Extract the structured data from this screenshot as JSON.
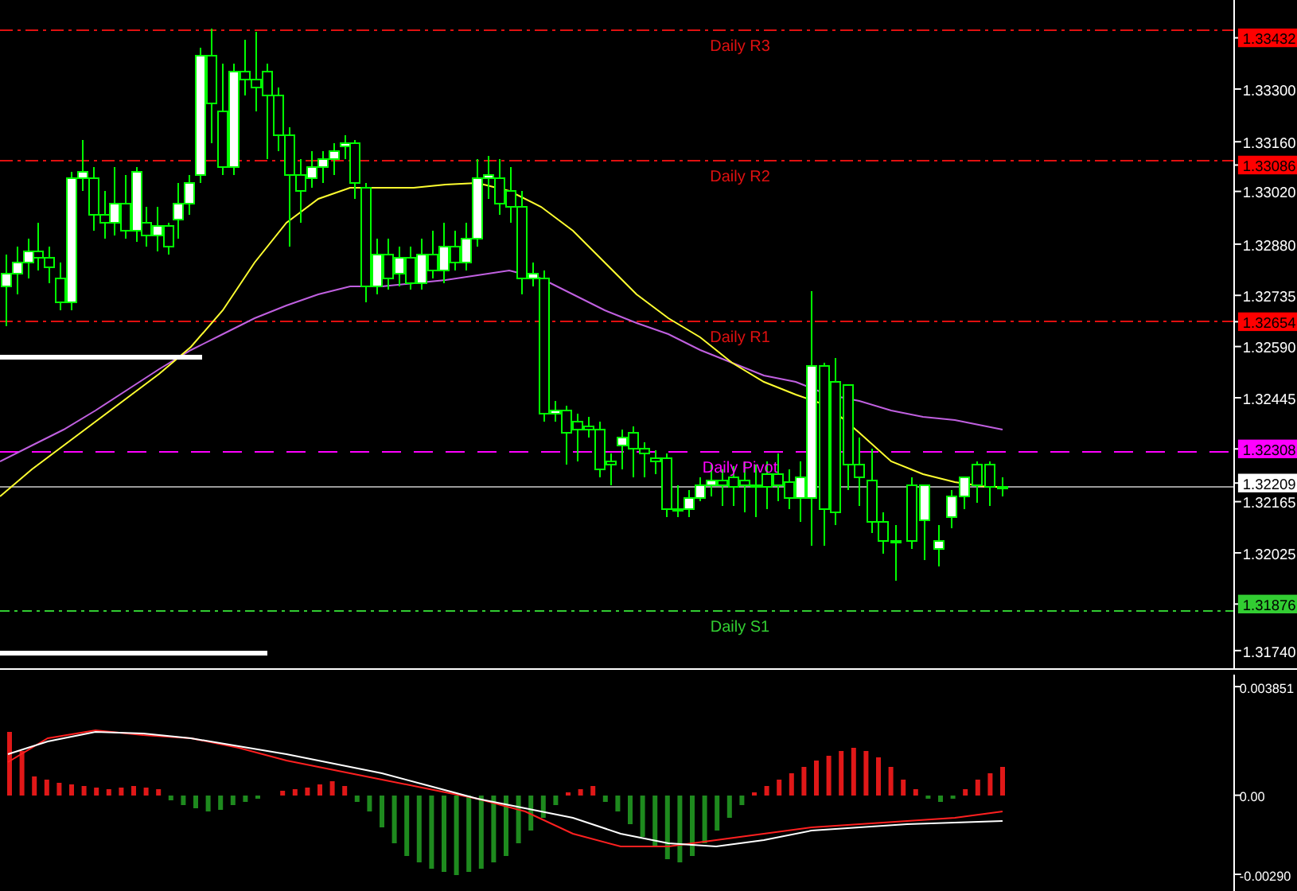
{
  "price_axis": {
    "labels": [
      {
        "text": "1.33432",
        "kind": "resistance"
      },
      {
        "text": "1.33300",
        "kind": "tick"
      },
      {
        "text": "1.33160",
        "kind": "tick"
      },
      {
        "text": "1.33086",
        "kind": "resistance"
      },
      {
        "text": "1.33020",
        "kind": "tick"
      },
      {
        "text": "1.32880",
        "kind": "tick"
      },
      {
        "text": "1.32735",
        "kind": "tick"
      },
      {
        "text": "1.32654",
        "kind": "resistance"
      },
      {
        "text": "1.32590",
        "kind": "tick"
      },
      {
        "text": "1.32445",
        "kind": "tick"
      },
      {
        "text": "1.32308",
        "kind": "pivot"
      },
      {
        "text": "1.32209",
        "kind": "current"
      },
      {
        "text": "1.32165",
        "kind": "tick"
      },
      {
        "text": "1.32025",
        "kind": "tick"
      },
      {
        "text": "1.31876",
        "kind": "support"
      },
      {
        "text": "1.31740",
        "kind": "tick"
      }
    ]
  },
  "levels": [
    {
      "label": "Daily R3",
      "kind": "resistance"
    },
    {
      "label": "Daily R2",
      "kind": "resistance"
    },
    {
      "label": "Daily R1",
      "kind": "resistance"
    },
    {
      "label": "Daily Pivot",
      "kind": "pivot"
    },
    {
      "label": "Daily S1",
      "kind": "support"
    }
  ],
  "indicator_axis": {
    "labels": [
      {
        "text": "0.003851"
      },
      {
        "text": "0.00"
      },
      {
        "text": "-0.00290"
      }
    ]
  }
}
